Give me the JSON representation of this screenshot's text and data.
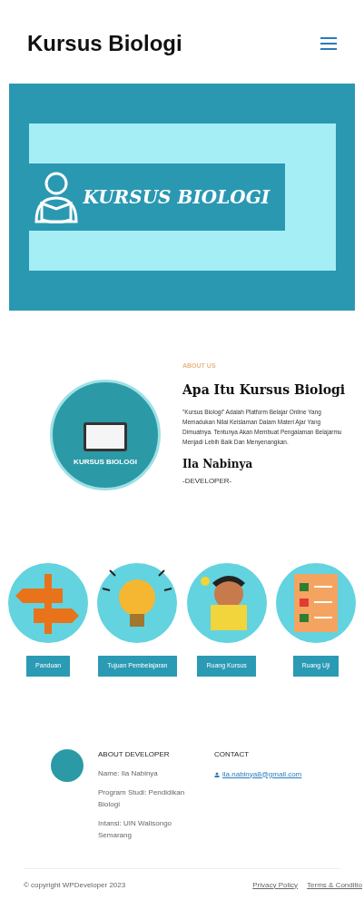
{
  "header": {
    "title": "Kursus Biologi"
  },
  "banner": {
    "title": "KURSUS BIOLOGI"
  },
  "about": {
    "logo_text": "KURSUS BIOLOGI",
    "eyebrow": "ABOUT US",
    "heading": "Apa Itu Kursus Biologi",
    "body": "\"Kursus Biologi\" Adalah Platform Belajar Online Yang Memadukan Nilai Keislaman Dalam Materi Ajar Yang Dimuatnya. Tentunya Akan Membuat Pengalaman Belajarmu Menjadi Lebih Baik Dan Menyenangkan.",
    "name": "Ila Nabinya",
    "role": "-DEVELOPER-"
  },
  "features": [
    {
      "kind": "signpost",
      "label": "Panduan"
    },
    {
      "kind": "bulb",
      "label": "Tujuan Pembelajaran"
    },
    {
      "kind": "reader",
      "label": "Ruang Kursus"
    },
    {
      "kind": "checklist",
      "label": "Ruang Uji"
    }
  ],
  "footer": {
    "about_title": "ABOUT DEVELOPER",
    "about_lines": [
      "Name: Ila Nabinya",
      "Program Studi: Pendidikan Biologi",
      "Intansi: UIN Walisongo Semarang"
    ],
    "contact_title": "CONTACT",
    "email": "ila.nabinya8@gmail.com",
    "copyright": "© copyright WPDeveloper 2023",
    "links": [
      "Privacy Policy",
      "Terms & Conditio"
    ]
  }
}
